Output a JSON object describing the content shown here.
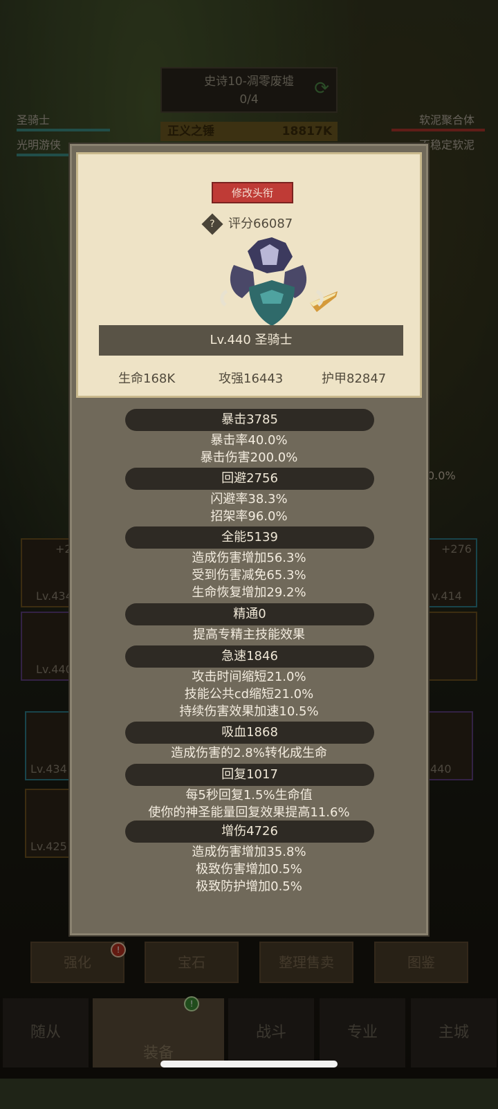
{
  "background": {
    "stage_title": "史诗10-凋零废墟",
    "stage_progress": "0/4",
    "boss_name": "正义之锤",
    "boss_power": "18817K",
    "left_team": [
      "圣骑士",
      "光明游侠"
    ],
    "right_team": [
      "软泥聚合体",
      "不稳定软泥"
    ],
    "side_items": [
      {
        "plus": "+2",
        "level": "Lv.434"
      },
      {
        "plus": "",
        "level": "Lv.440"
      },
      {
        "plus": "+276",
        "level": "v.414"
      },
      {
        "plus": "",
        "level": "Lv.434"
      },
      {
        "plus": "",
        "level": "Lv.425"
      },
      {
        "plus": "",
        "level": "440"
      }
    ],
    "right_percent": "0.0%",
    "tabs": [
      "强化",
      "宝石",
      "整理售卖",
      "图鉴"
    ],
    "tab_badge": "!",
    "bottom_nav": [
      "随从",
      "装备",
      "战斗",
      "专业",
      "主城"
    ],
    "nav_badge": "!"
  },
  "popup": {
    "title_button": "修改头衔",
    "score_icon": "?",
    "score": "评分66087",
    "hero_name": "Lv.440 圣骑士",
    "stats": {
      "hp": "生命168K",
      "attack": "攻强16443",
      "armor": "护甲82847"
    },
    "attributes": [
      {
        "head": "暴击3785",
        "lines": [
          "暴击率40.0%",
          "暴击伤害200.0%"
        ]
      },
      {
        "head": "回避2756",
        "lines": [
          "闪避率38.3%",
          "招架率96.0%"
        ]
      },
      {
        "head": "全能5139",
        "lines": [
          "造成伤害增加56.3%",
          "受到伤害减免65.3%",
          "生命恢复增加29.2%"
        ]
      },
      {
        "head": "精通0",
        "lines": [
          "提高专精主技能效果"
        ]
      },
      {
        "head": "急速1846",
        "lines": [
          "攻击时间缩短21.0%",
          "技能公共cd缩短21.0%",
          "持续伤害效果加速10.5%"
        ]
      },
      {
        "head": "吸血1868",
        "lines": [
          "造成伤害的2.8%转化成生命"
        ]
      },
      {
        "head": "回复1017",
        "lines": [
          "每5秒回复1.5%生命值",
          "使你的神圣能量回复效果提高11.6%"
        ]
      },
      {
        "head": "增伤4726",
        "lines": [
          "造成伤害增加35.8%",
          "极致伤害增加0.5%",
          "极致防护增加0.5%"
        ]
      }
    ]
  }
}
